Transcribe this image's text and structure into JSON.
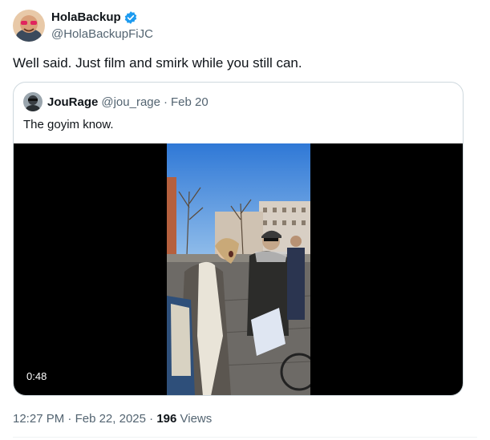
{
  "author": {
    "display_name": "HolaBackup",
    "handle": "@HolaBackupFiJC",
    "verified_icon": "verified-badge-icon",
    "verified_color": "#1d9bf0"
  },
  "tweet": {
    "text": "Well said. Just film and smirk while you still can."
  },
  "quoted": {
    "display_name": "JouRage",
    "handle": "@jou_rage",
    "separator": "·",
    "date": "Feb 20",
    "text": "The goyim know.",
    "video": {
      "duration": "0:48",
      "play_icon": "video-thumbnail"
    }
  },
  "meta": {
    "time": "12:27 PM",
    "separator1": " · ",
    "date": "Feb 22, 2025",
    "separator2": " · ",
    "views_count": "196",
    "views_label": " Views"
  },
  "colors": {
    "text": "#0f1419",
    "secondary": "#536471",
    "border": "#cfd9de",
    "accent": "#1d9bf0"
  }
}
